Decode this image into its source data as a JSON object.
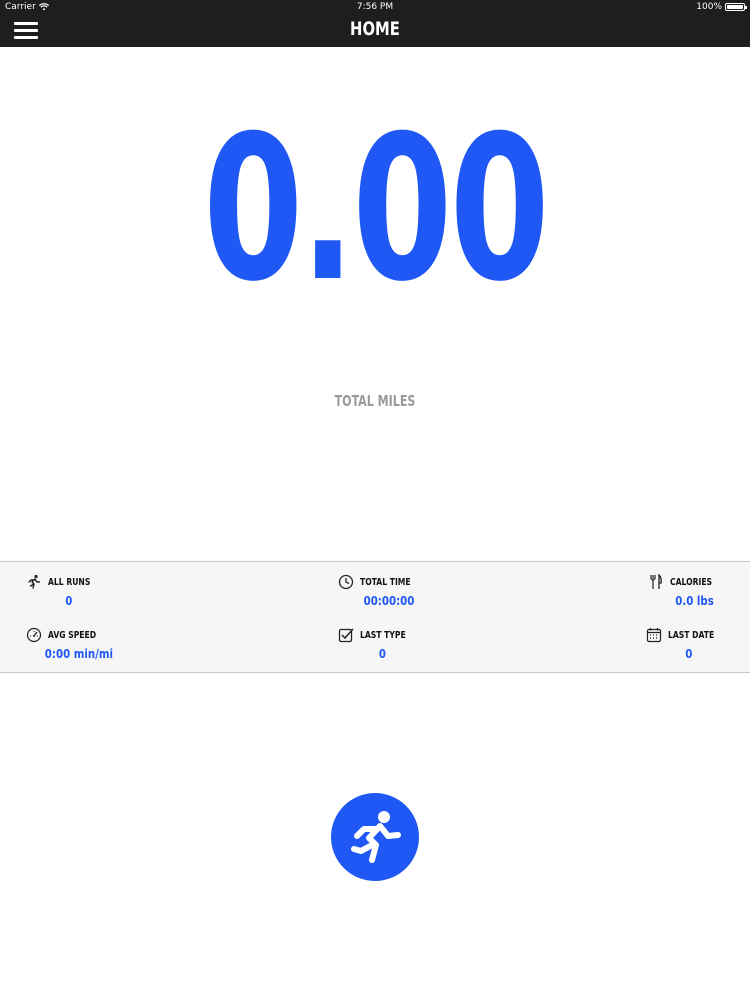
{
  "status_bar": {
    "carrier": "Carrier",
    "time": "7:56 PM",
    "battery": "100%"
  },
  "navbar": {
    "title": "HOME"
  },
  "summary": {
    "value": "0.00",
    "label": "TOTAL MILES"
  },
  "stats": {
    "all_runs": {
      "label": "ALL RUNS",
      "value": "0"
    },
    "total_time": {
      "label": "TOTAL TIME",
      "value": "00:00:00"
    },
    "calories": {
      "label": "CALORIES",
      "value": "0.0 lbs"
    },
    "avg_speed": {
      "label": "AVG SPEED",
      "value": "0:00 min/mi"
    },
    "last_type": {
      "label": "LAST TYPE",
      "value": "0"
    },
    "last_date": {
      "label": "LAST DATE",
      "value": "0"
    }
  },
  "colors": {
    "accent": "#1f58f5",
    "bar": "#1e1e1e",
    "muted": "#9a9a9a"
  },
  "icons": {
    "menu": "hamburger-icon",
    "runner": "runner-icon",
    "clock": "clock-icon",
    "fork_knife": "fork-knife-icon",
    "speed": "speedometer-icon",
    "checkbox": "checkbox-icon",
    "calendar": "calendar-icon",
    "run_button": "runner-icon"
  }
}
